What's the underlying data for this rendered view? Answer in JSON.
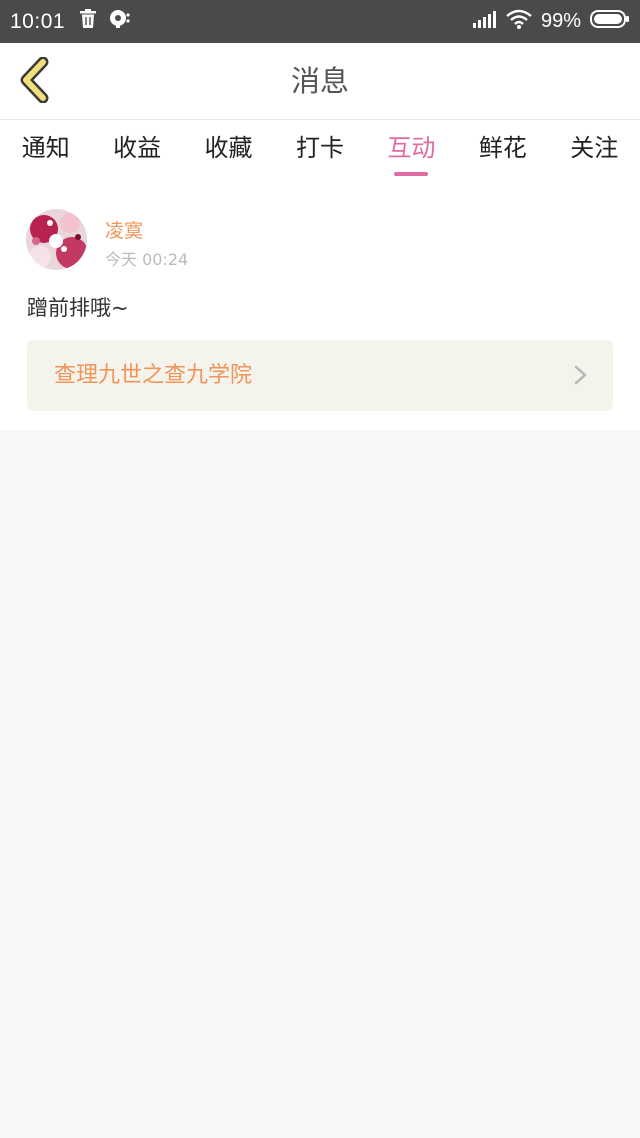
{
  "status_bar": {
    "time": "10:01",
    "battery_text": "99%",
    "icons": [
      "trash-icon",
      "notification-icon",
      "signal-icon",
      "wifi-icon",
      "battery-icon"
    ]
  },
  "header": {
    "title": "消息",
    "back_icon": "chevron-left-icon",
    "back_icon_color": "#f1e07a"
  },
  "tabs": [
    {
      "label": "通知",
      "active": false
    },
    {
      "label": "收益",
      "active": false
    },
    {
      "label": "收藏",
      "active": false
    },
    {
      "label": "打卡",
      "active": false
    },
    {
      "label": "互动",
      "active": true
    },
    {
      "label": "鲜花",
      "active": false
    },
    {
      "label": "关注",
      "active": false
    }
  ],
  "message": {
    "username": "凌寞",
    "timestamp": "今天 00:24",
    "text": "蹭前排哦~",
    "link_title": "查理九世之查九学院",
    "link_icon": "chevron-right-icon"
  },
  "colors": {
    "accent": "#e06aa2",
    "username": "#f0955a",
    "link_bg": "#f4f3ec",
    "status_bar_bg": "#4a4a4a",
    "page_bg": "#f8f6f6"
  }
}
